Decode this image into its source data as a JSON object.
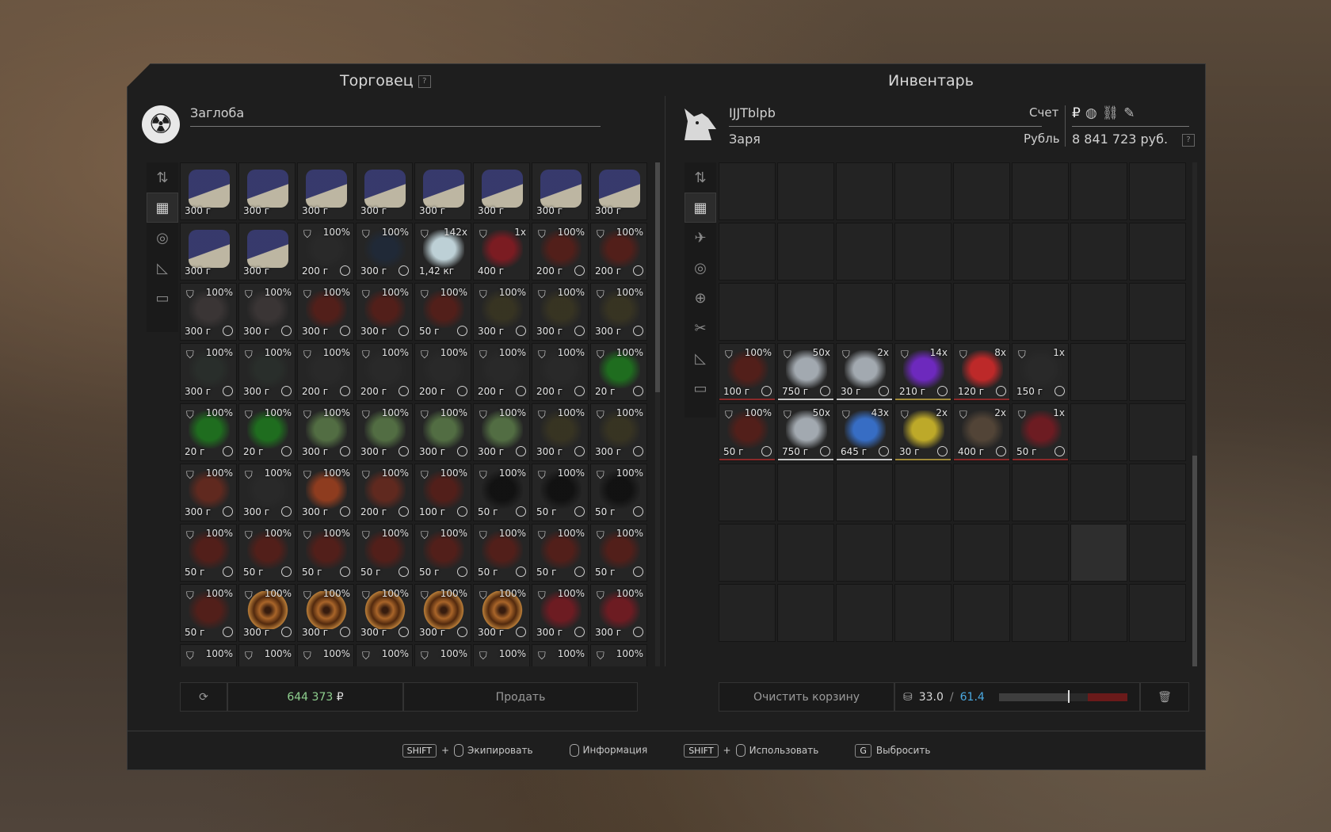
{
  "trader": {
    "title": "Торговец",
    "help": "?",
    "name": "Заглоба",
    "sell_total": "644 373",
    "currency_sign": "₽",
    "sell_button": "Продать",
    "items": [
      {
        "cond": "",
        "price": "300 г",
        "clock": false,
        "art": "book"
      },
      {
        "cond": "",
        "price": "300 г",
        "clock": false,
        "art": "book"
      },
      {
        "cond": "",
        "price": "300 г",
        "clock": false,
        "art": "book"
      },
      {
        "cond": "",
        "price": "300 г",
        "clock": false,
        "art": "book"
      },
      {
        "cond": "",
        "price": "300 г",
        "clock": false,
        "art": "book"
      },
      {
        "cond": "",
        "price": "300 г",
        "clock": false,
        "art": "book"
      },
      {
        "cond": "",
        "price": "300 г",
        "clock": false,
        "art": "book"
      },
      {
        "cond": "",
        "price": "300 г",
        "clock": false,
        "art": "book"
      },
      {
        "cond": "",
        "price": "300 г",
        "clock": false,
        "art": "book"
      },
      {
        "cond": "",
        "price": "300 г",
        "clock": false,
        "art": "book"
      },
      {
        "cond": "100%",
        "price": "200 г",
        "clock": true,
        "art": "dark"
      },
      {
        "cond": "100%",
        "price": "300 г",
        "clock": true,
        "art": "navy"
      },
      {
        "cond": "142x",
        "price": "1,42 кг",
        "clock": false,
        "art": "ice"
      },
      {
        "cond": "1x",
        "price": "400 г",
        "clock": false,
        "art": "red"
      },
      {
        "cond": "100%",
        "price": "200 г",
        "clock": true,
        "art": "maroon"
      },
      {
        "cond": "100%",
        "price": "200 г",
        "clock": true,
        "art": "maroon"
      },
      {
        "cond": "100%",
        "price": "300 г",
        "clock": true,
        "art": "grey"
      },
      {
        "cond": "100%",
        "price": "300 г",
        "clock": true,
        "art": "grey"
      },
      {
        "cond": "100%",
        "price": "300 г",
        "clock": true,
        "art": "maroon"
      },
      {
        "cond": "100%",
        "price": "300 г",
        "clock": true,
        "art": "maroon"
      },
      {
        "cond": "100%",
        "price": "50 г",
        "clock": true,
        "art": "maroon"
      },
      {
        "cond": "100%",
        "price": "300 г",
        "clock": true,
        "art": "olive"
      },
      {
        "cond": "100%",
        "price": "300 г",
        "clock": true,
        "art": "olive"
      },
      {
        "cond": "100%",
        "price": "300 г",
        "clock": true,
        "art": "olive"
      },
      {
        "cond": "100%",
        "price": "300 г",
        "clock": true,
        "art": "slate"
      },
      {
        "cond": "100%",
        "price": "300 г",
        "clock": true,
        "art": "slate"
      },
      {
        "cond": "100%",
        "price": "200 г",
        "clock": true,
        "art": "dark"
      },
      {
        "cond": "100%",
        "price": "200 г",
        "clock": true,
        "art": "dark"
      },
      {
        "cond": "100%",
        "price": "200 г",
        "clock": true,
        "art": "dark"
      },
      {
        "cond": "100%",
        "price": "200 г",
        "clock": true,
        "art": "dark"
      },
      {
        "cond": "100%",
        "price": "200 г",
        "clock": true,
        "art": "dark"
      },
      {
        "cond": "100%",
        "price": "20 г",
        "clock": true,
        "art": "green"
      },
      {
        "cond": "100%",
        "price": "20 г",
        "clock": true,
        "art": "green"
      },
      {
        "cond": "100%",
        "price": "20 г",
        "clock": true,
        "art": "green"
      },
      {
        "cond": "100%",
        "price": "300 г",
        "clock": true,
        "art": "sage"
      },
      {
        "cond": "100%",
        "price": "300 г",
        "clock": true,
        "art": "sage"
      },
      {
        "cond": "100%",
        "price": "300 г",
        "clock": true,
        "art": "sage"
      },
      {
        "cond": "100%",
        "price": "300 г",
        "clock": true,
        "art": "sage"
      },
      {
        "cond": "100%",
        "price": "300 г",
        "clock": true,
        "art": "olive"
      },
      {
        "cond": "100%",
        "price": "300 г",
        "clock": true,
        "art": "olive"
      },
      {
        "cond": "100%",
        "price": "300 г",
        "clock": true,
        "art": "rust"
      },
      {
        "cond": "100%",
        "price": "300 г",
        "clock": true,
        "art": "dark"
      },
      {
        "cond": "100%",
        "price": "300 г",
        "clock": true,
        "art": "orange"
      },
      {
        "cond": "100%",
        "price": "200 г",
        "clock": true,
        "art": "rust"
      },
      {
        "cond": "100%",
        "price": "100 г",
        "clock": true,
        "art": "maroon"
      },
      {
        "cond": "100%",
        "price": "50 г",
        "clock": true,
        "art": "black"
      },
      {
        "cond": "100%",
        "price": "50 г",
        "clock": true,
        "art": "black"
      },
      {
        "cond": "100%",
        "price": "50 г",
        "clock": true,
        "art": "black"
      },
      {
        "cond": "100%",
        "price": "50 г",
        "clock": true,
        "art": "maroon"
      },
      {
        "cond": "100%",
        "price": "50 г",
        "clock": true,
        "art": "maroon"
      },
      {
        "cond": "100%",
        "price": "50 г",
        "clock": true,
        "art": "maroon"
      },
      {
        "cond": "100%",
        "price": "50 г",
        "clock": true,
        "art": "maroon"
      },
      {
        "cond": "100%",
        "price": "50 г",
        "clock": true,
        "art": "maroon"
      },
      {
        "cond": "100%",
        "price": "50 г",
        "clock": true,
        "art": "maroon"
      },
      {
        "cond": "100%",
        "price": "50 г",
        "clock": true,
        "art": "maroon"
      },
      {
        "cond": "100%",
        "price": "50 г",
        "clock": true,
        "art": "maroon"
      },
      {
        "cond": "100%",
        "price": "50 г",
        "clock": true,
        "art": "maroon"
      },
      {
        "cond": "100%",
        "price": "300 г",
        "clock": true,
        "art": "swirl"
      },
      {
        "cond": "100%",
        "price": "300 г",
        "clock": true,
        "art": "swirl"
      },
      {
        "cond": "100%",
        "price": "300 г",
        "clock": true,
        "art": "swirl"
      },
      {
        "cond": "100%",
        "price": "300 г",
        "clock": true,
        "art": "swirl"
      },
      {
        "cond": "100%",
        "price": "300 г",
        "clock": true,
        "art": "swirl"
      },
      {
        "cond": "100%",
        "price": "300 г",
        "clock": true,
        "art": "crimson"
      },
      {
        "cond": "100%",
        "price": "300 г",
        "clock": true,
        "art": "crimson"
      },
      {
        "cond": "100%",
        "price": "",
        "clock": false,
        "art": "none"
      },
      {
        "cond": "100%",
        "price": "",
        "clock": false,
        "art": "none"
      },
      {
        "cond": "100%",
        "price": "",
        "clock": false,
        "art": "none"
      },
      {
        "cond": "100%",
        "price": "",
        "clock": false,
        "art": "none"
      },
      {
        "cond": "100%",
        "price": "",
        "clock": false,
        "art": "none"
      },
      {
        "cond": "100%",
        "price": "",
        "clock": false,
        "art": "none"
      },
      {
        "cond": "100%",
        "price": "",
        "clock": false,
        "art": "none"
      },
      {
        "cond": "100%",
        "price": "",
        "clock": false,
        "art": "none"
      }
    ]
  },
  "inventory": {
    "title": "Инвентарь",
    "player_name": "IJJTblpb",
    "faction": "Заря",
    "account_label": "Счет",
    "currency_label": "Рубль",
    "balance": "8 841 723 руб.",
    "help": "?",
    "clear_cart": "Очистить корзину",
    "weight_current": "33.0",
    "weight_sep": "/",
    "weight_max": "61.4",
    "weight_fraction": 0.537,
    "items": [
      {
        "cond": "100%",
        "price": "100 г",
        "art": "maroon",
        "under": "red"
      },
      {
        "cond": "50x",
        "price": "750 г",
        "art": "silver",
        "under": "white"
      },
      {
        "cond": "2x",
        "price": "30 г",
        "art": "silver",
        "under": "white"
      },
      {
        "cond": "14x",
        "price": "210 г",
        "art": "purple",
        "under": "gold"
      },
      {
        "cond": "8x",
        "price": "120 г",
        "art": "redgem",
        "under": "red"
      },
      {
        "cond": "1x",
        "price": "150 г",
        "art": "dark",
        "under": "none"
      },
      {
        "cond": "100%",
        "price": "50 г",
        "art": "maroon",
        "under": "red"
      },
      {
        "cond": "50x",
        "price": "750 г",
        "art": "silver",
        "under": "white"
      },
      {
        "cond": "43x",
        "price": "645 г",
        "art": "blue",
        "under": "white"
      },
      {
        "cond": "2x",
        "price": "30 г",
        "art": "yellow",
        "under": "gold"
      },
      {
        "cond": "2x",
        "price": "400 г",
        "art": "tablet",
        "under": "red"
      },
      {
        "cond": "1x",
        "price": "50 г",
        "art": "crimson",
        "under": "red"
      }
    ]
  },
  "footer": {
    "shift_key": "SHIFT",
    "plus": "+",
    "equip": "Экипировать",
    "info": "Информация",
    "use": "Использовать",
    "drop_key": "G",
    "drop": "Выбросить"
  },
  "art_colors": {
    "book": "#3a3d78",
    "dark": "#2a2a2a",
    "navy": "#1f2a3a",
    "ice": "#d8eef5",
    "red": "#8a1a22",
    "maroon": "#5a1e18",
    "grey": "#3e3838",
    "olive": "#3a3622",
    "slate": "#2a302c",
    "green": "#1e7a1e",
    "sage": "#5a7a48",
    "rust": "#6a2a1e",
    "orange": "#a0401e",
    "black": "#0e0e0e",
    "swirl": "#b0602a",
    "crimson": "#7a1a22",
    "silver": "#b8c0c8",
    "purple": "#7a2ad8",
    "redgem": "#d82a2a",
    "blue": "#3a7ae0",
    "yellow": "#d8c02a",
    "tablet": "#5a4a3a",
    "none": "transparent"
  }
}
